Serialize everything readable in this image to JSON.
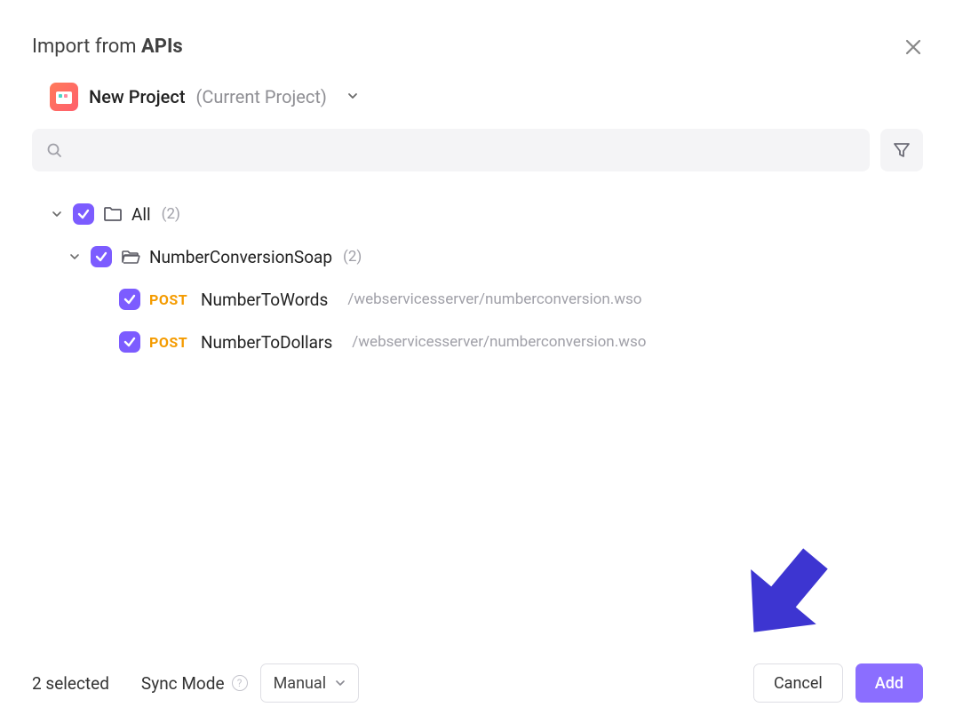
{
  "dialog": {
    "title_prefix": "Import from ",
    "title_bold": "APIs"
  },
  "project": {
    "name": "New Project",
    "suffix": "(Current Project)"
  },
  "search": {
    "placeholder": ""
  },
  "tree": {
    "root": {
      "label": "All",
      "count": "(2)"
    },
    "group": {
      "label": "NumberConversionSoap",
      "count": "(2)"
    },
    "endpoints": [
      {
        "method": "POST",
        "name": "NumberToWords",
        "path": "/webservicesserver/numberconversion.wso"
      },
      {
        "method": "POST",
        "name": "NumberToDollars",
        "path": "/webservicesserver/numberconversion.wso"
      }
    ]
  },
  "footer": {
    "selected": "2 selected",
    "sync_label": "Sync Mode",
    "sync_value": "Manual",
    "cancel": "Cancel",
    "add": "Add"
  }
}
